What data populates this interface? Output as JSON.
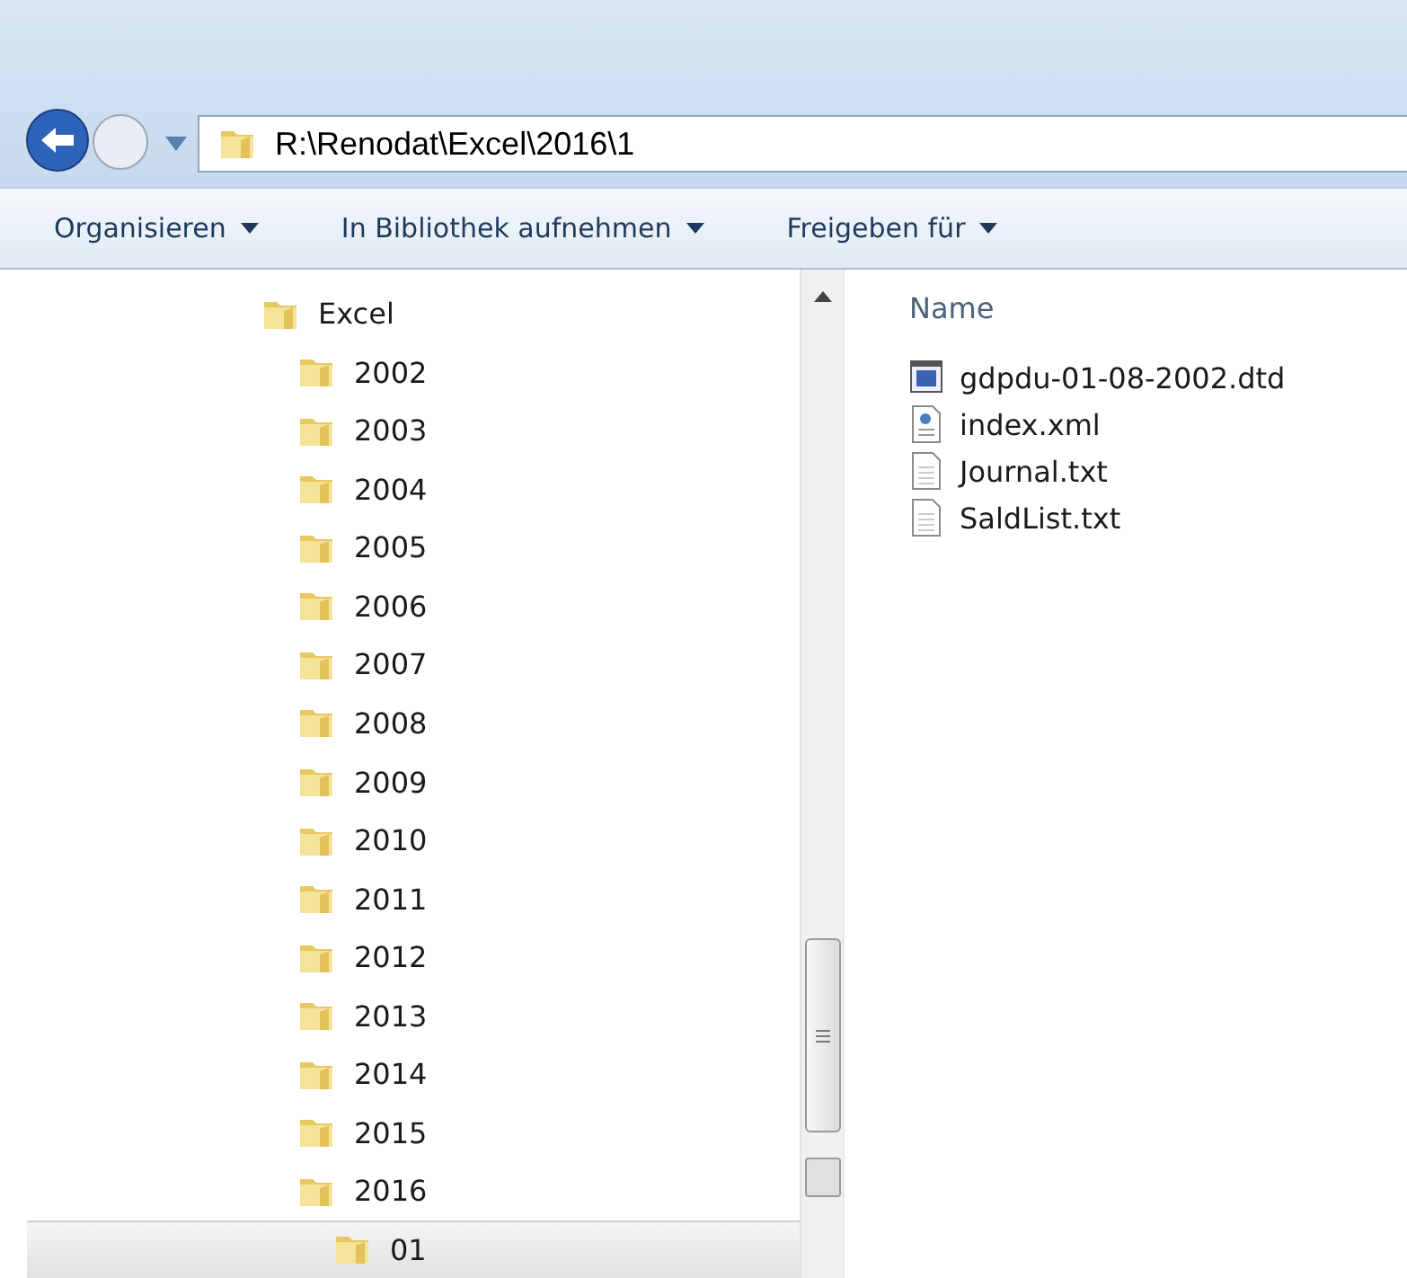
{
  "address_bar": {
    "path": "R:\\Renodat\\Excel\\2016\\1"
  },
  "toolbar": [
    "Organisieren",
    "In Bibliothek aufnehmen",
    "Freigeben für"
  ],
  "tree": [
    {
      "label": "Excel",
      "selected": false,
      "children": [
        {
          "label": "2002",
          "selected": false
        },
        {
          "label": "2003",
          "selected": false
        },
        {
          "label": "2004",
          "selected": false
        },
        {
          "label": "2005",
          "selected": false
        },
        {
          "label": "2006",
          "selected": false
        },
        {
          "label": "2007",
          "selected": false
        },
        {
          "label": "2008",
          "selected": false
        },
        {
          "label": "2009",
          "selected": false
        },
        {
          "label": "2010",
          "selected": false
        },
        {
          "label": "2011",
          "selected": false
        },
        {
          "label": "2012",
          "selected": false
        },
        {
          "label": "2013",
          "selected": false
        },
        {
          "label": "2014",
          "selected": false
        },
        {
          "label": "2015",
          "selected": false
        },
        {
          "label": "2016",
          "selected": false,
          "children": [
            {
              "label": "01",
              "selected": true
            }
          ]
        }
      ]
    }
  ],
  "file_list": {
    "column": "Name",
    "files": [
      {
        "name": "gdpdu-01-08-2002.dtd",
        "kind": "dtd"
      },
      {
        "name": "index.xml",
        "kind": "xml"
      },
      {
        "name": "Journal.txt",
        "kind": "txt"
      },
      {
        "name": "SaldList.txt",
        "kind": "txt"
      }
    ]
  }
}
